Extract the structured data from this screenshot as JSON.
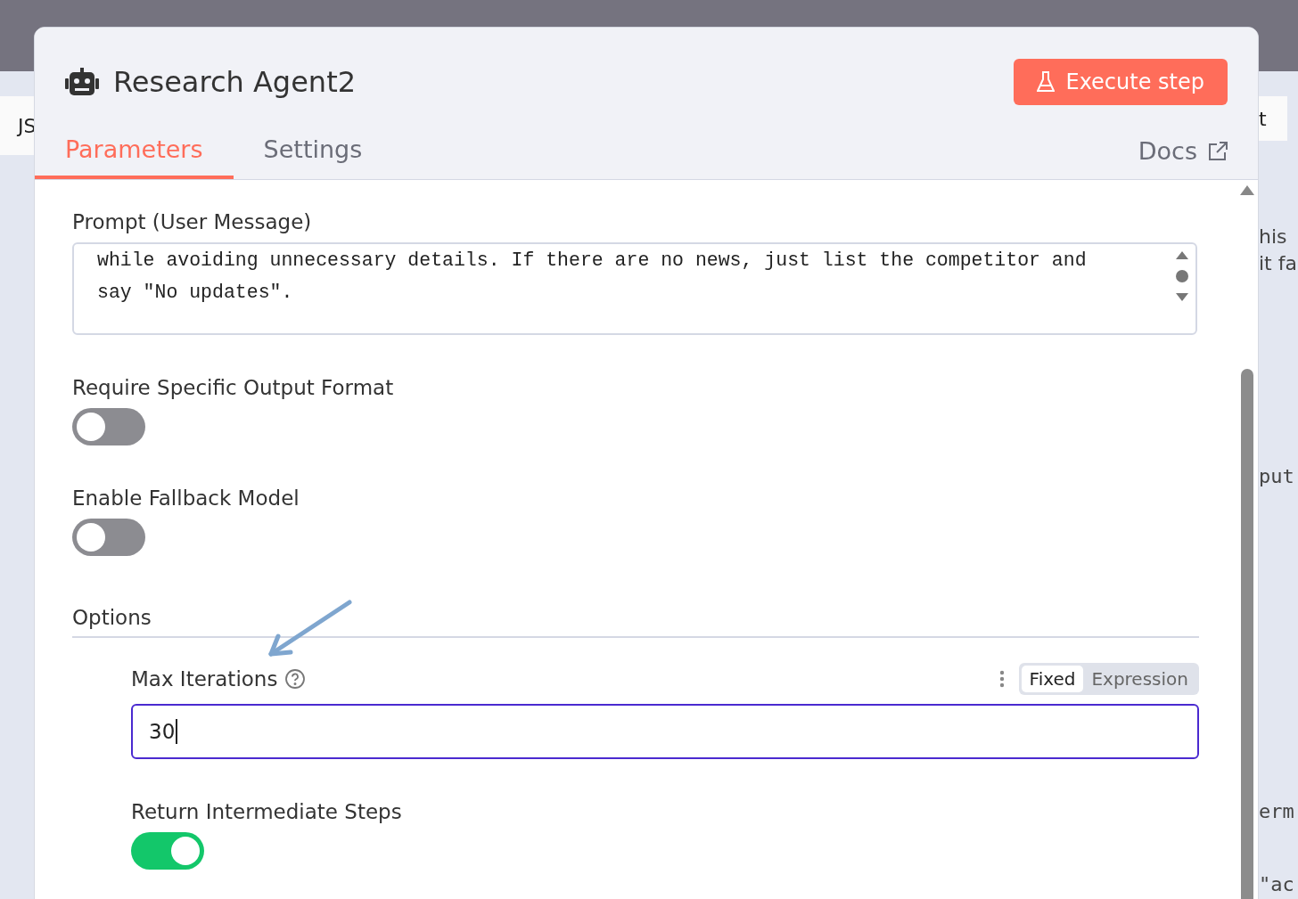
{
  "background": {
    "left_tab": "JS",
    "right_texts": [
      "t",
      "his",
      "it fa",
      "put",
      "erm",
      "\"ac"
    ]
  },
  "modal": {
    "title": "Research Agent2",
    "execute_button": "Execute step",
    "tabs": [
      {
        "label": "Parameters",
        "selected": true
      },
      {
        "label": "Settings",
        "selected": false
      }
    ],
    "docs_link": "Docs",
    "prompt": {
      "label": "Prompt (User Message)",
      "lines": [
        "while avoiding unnecessary details. If there are no news, just list the competitor and",
        "say \"No updates\"."
      ]
    },
    "toggles": [
      {
        "label": "Require Specific Output Format",
        "on": false
      },
      {
        "label": "Enable Fallback Model",
        "on": false
      }
    ],
    "options": {
      "title": "Options",
      "max_iterations": {
        "label": "Max Iterations",
        "modes": [
          {
            "label": "Fixed",
            "selected": true
          },
          {
            "label": "Expression",
            "selected": false
          }
        ],
        "value": "30"
      },
      "return_steps": {
        "label": "Return Intermediate Steps",
        "on": true
      }
    }
  }
}
